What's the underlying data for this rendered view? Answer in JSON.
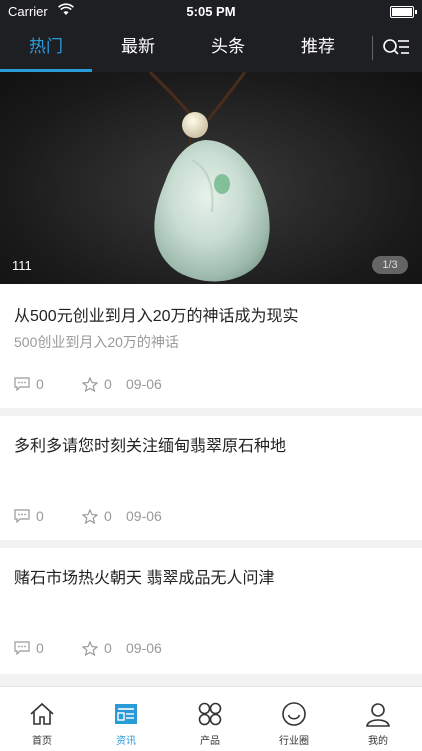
{
  "status_bar": {
    "carrier": "Carrier",
    "time": "5:05 PM"
  },
  "tabs": [
    {
      "label": "热门",
      "active": true
    },
    {
      "label": "最新",
      "active": false
    },
    {
      "label": "头条",
      "active": false
    },
    {
      "label": "推荐",
      "active": false
    }
  ],
  "banner": {
    "caption": "111",
    "counter": "1/3"
  },
  "articles": [
    {
      "title": "从500元创业到月入20万的神话成为现实",
      "subtitle": "500创业到月入20万的神话",
      "comments": "0",
      "likes": "0",
      "date": "09-06"
    },
    {
      "title": "多利多请您时刻关注缅甸翡翠原石种地",
      "subtitle": "",
      "comments": "0",
      "likes": "0",
      "date": "09-06"
    },
    {
      "title": "赌石市场热火朝天 翡翠成品无人问津",
      "subtitle": "",
      "comments": "0",
      "likes": "0",
      "date": "09-06"
    }
  ],
  "bottom_nav": [
    {
      "label": "首页",
      "icon": "home-icon",
      "active": false
    },
    {
      "label": "资讯",
      "icon": "news-icon",
      "active": true
    },
    {
      "label": "产品",
      "icon": "grid-icon",
      "active": false
    },
    {
      "label": "行业圈",
      "icon": "smiley-icon",
      "active": false
    },
    {
      "label": "我的",
      "icon": "user-icon",
      "active": false
    }
  ],
  "colors": {
    "accent": "#2a9bd8",
    "header_bg": "#1e1f23"
  }
}
